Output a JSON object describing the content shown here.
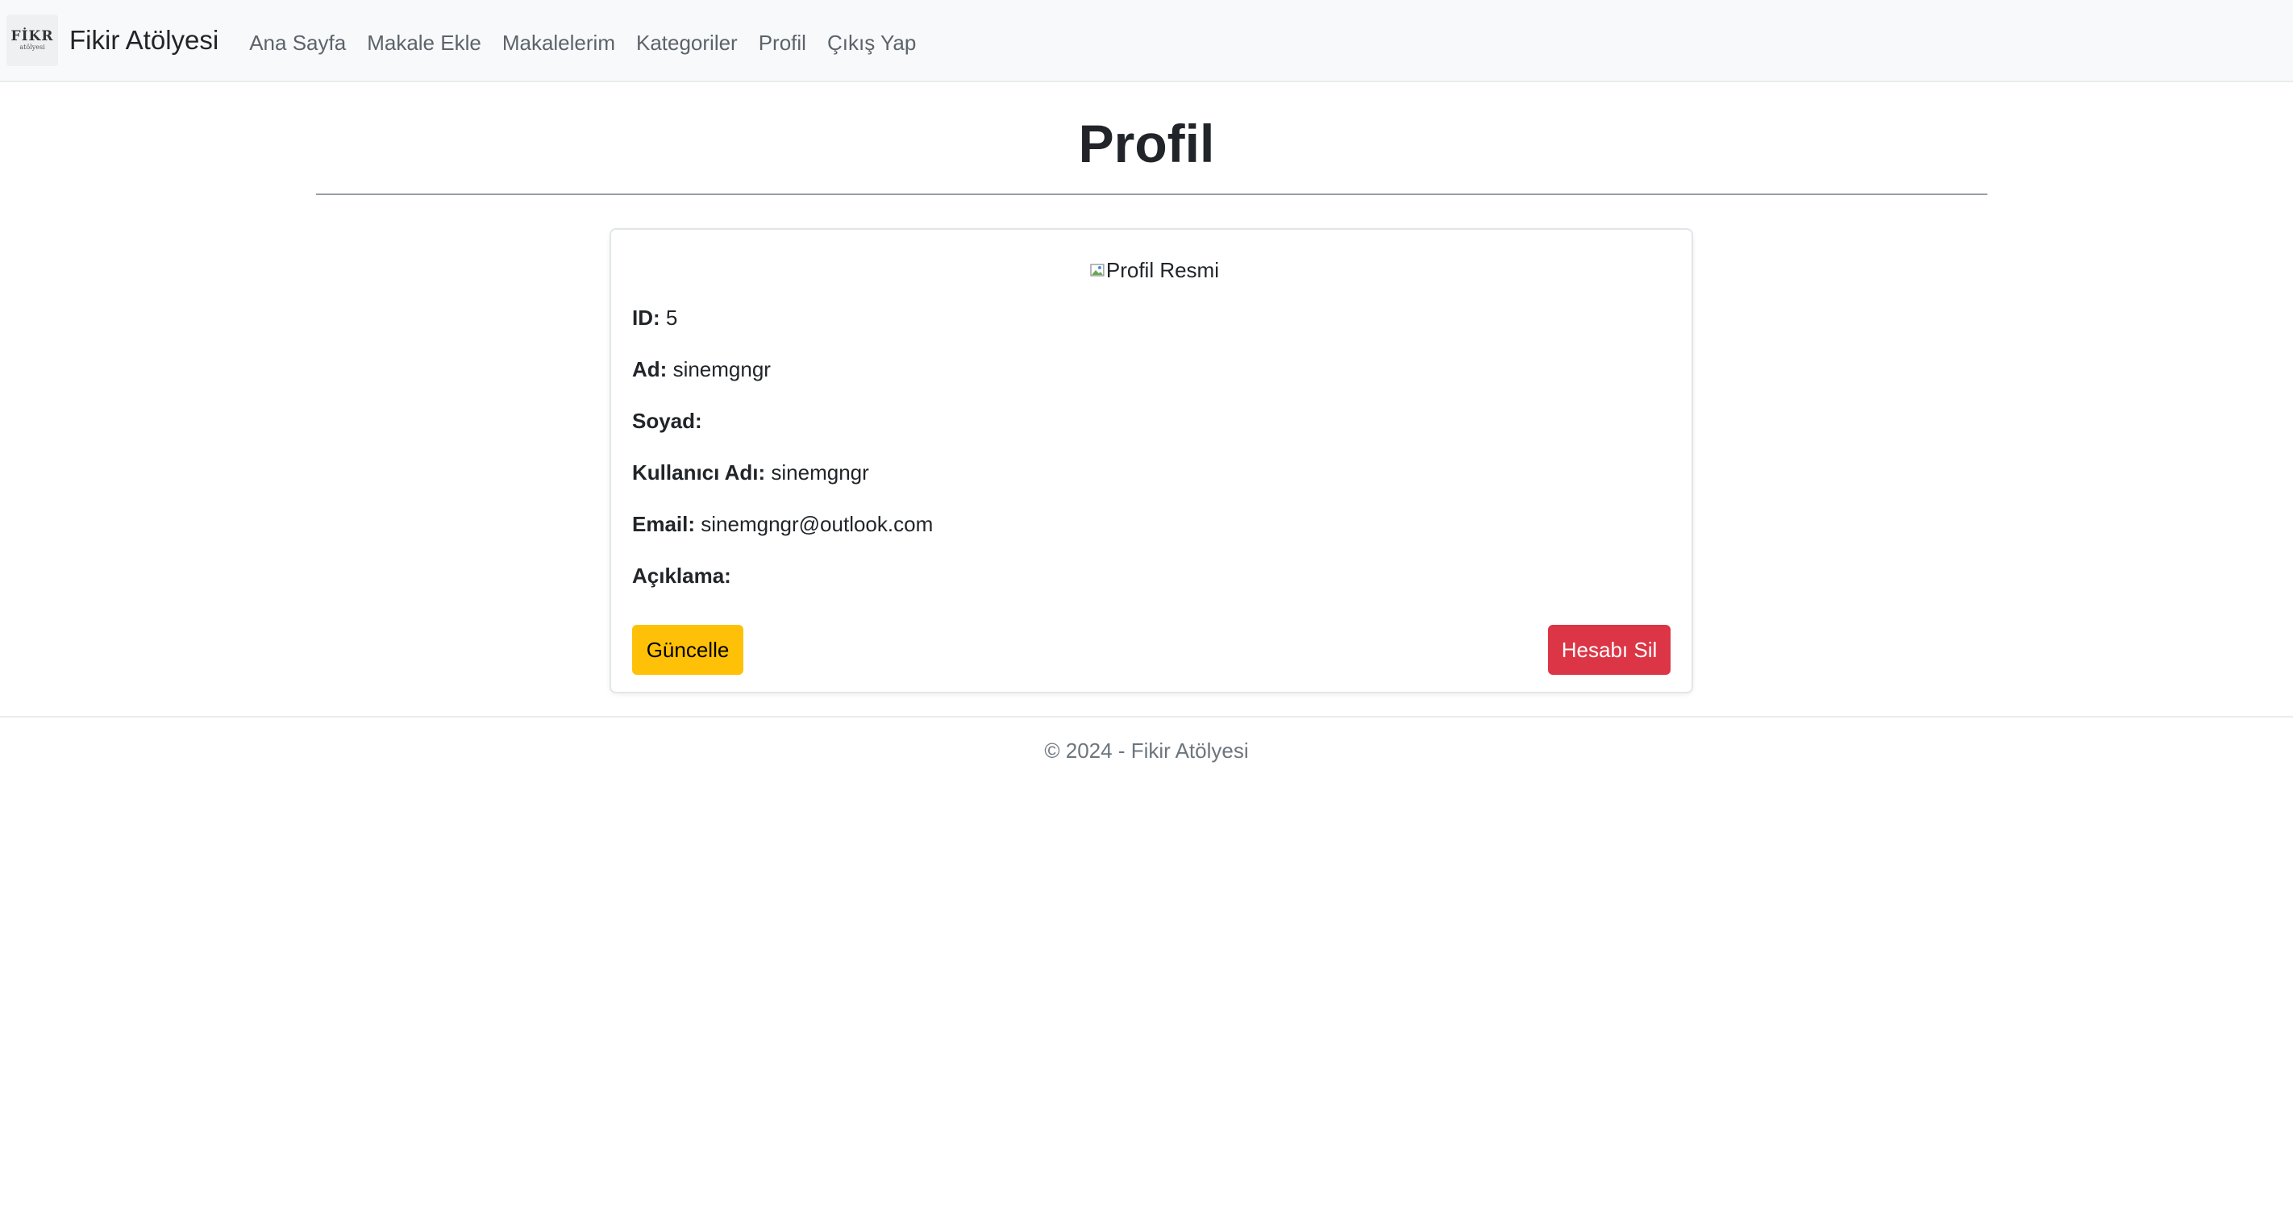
{
  "navbar": {
    "logo_text_top": "FİKR",
    "logo_text_bottom": "atölyesi",
    "brand": "Fikir Atölyesi",
    "links": [
      {
        "label": "Ana Sayfa"
      },
      {
        "label": "Makale Ekle"
      },
      {
        "label": "Makalelerim"
      },
      {
        "label": "Kategoriler"
      },
      {
        "label": "Profil"
      },
      {
        "label": "Çıkış Yap"
      }
    ]
  },
  "page": {
    "title": "Profil"
  },
  "profile": {
    "image_alt": "Profil Resmi",
    "fields": [
      {
        "label": "ID:",
        "value": "5"
      },
      {
        "label": "Ad:",
        "value": "sinemgngr"
      },
      {
        "label": "Soyad:",
        "value": ""
      },
      {
        "label": "Kullanıcı Adı:",
        "value": "sinemgngr"
      },
      {
        "label": "Email:",
        "value": "sinemgngr@outlook.com"
      },
      {
        "label": "Açıklama:",
        "value": ""
      }
    ],
    "update_label": "Güncelle",
    "delete_label": "Hesabı Sil"
  },
  "footer": {
    "text": "© 2024 - Fikir Atölyesi"
  },
  "colors": {
    "update_button": "#ffc107",
    "delete_button": "#dc3545",
    "navbar_bg": "#f8f9fa"
  }
}
